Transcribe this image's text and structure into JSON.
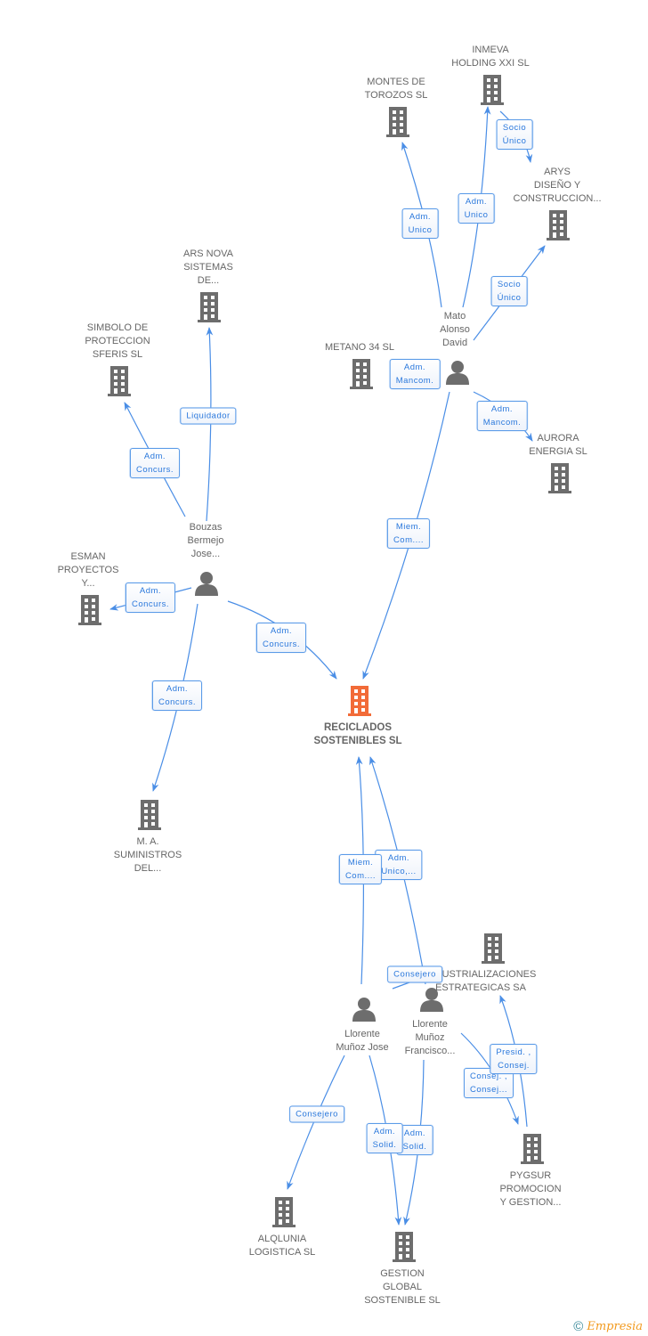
{
  "colors": {
    "edge": "#4a8ee6",
    "icon": "#6d6d6d",
    "focus": "#f26b38",
    "label_text": "#2a78dc"
  },
  "nodes": {
    "inmeva": {
      "label": "INMEVA\nHOLDING XXI SL",
      "type": "company"
    },
    "montes": {
      "label": "MONTES DE\nTOROZOS SL",
      "type": "company"
    },
    "arys": {
      "label": "ARYS\nDISEÑO Y\nCONSTRUCCION...",
      "type": "company"
    },
    "metano": {
      "label": "METANO 34 SL",
      "type": "company"
    },
    "aurora": {
      "label": "AURORA\nENERGIA SL",
      "type": "company"
    },
    "mato": {
      "label": "Mato\nAlonso\nDavid",
      "type": "person"
    },
    "arsnova": {
      "label": "ARS NOVA\nSISTEMAS\nDE...",
      "type": "company"
    },
    "simbolo": {
      "label": "SIMBOLO DE\nPROTECCION\nSFERIS SL",
      "type": "company"
    },
    "bouzas": {
      "label": "Bouzas\nBermejo\nJose...",
      "type": "person"
    },
    "esman": {
      "label": "ESMAN\nPROYECTOS\nY...",
      "type": "company"
    },
    "reciclados": {
      "label": "RECICLADOS\nSOSTENIBLES SL",
      "type": "company-focus"
    },
    "ma": {
      "label": "M. A.\nSUMINISTROS\nDEL...",
      "type": "company"
    },
    "industrializaciones": {
      "label": "INDUSTRIALIZACIONES\nESTRATEGICAS SA",
      "type": "company"
    },
    "ljose": {
      "label": "Llorente\nMuñoz Jose",
      "type": "person"
    },
    "lfrancisco": {
      "label": "Llorente\nMuñoz\nFrancisco...",
      "type": "person"
    },
    "pygsur": {
      "label": "PYGSUR\nPROMOCION\nY GESTION...",
      "type": "company"
    },
    "alqlunia": {
      "label": "ALQLUNIA\nLOGISTICA SL",
      "type": "company"
    },
    "gestion": {
      "label": "GESTION\nGLOBAL\nSOSTENIBLE SL",
      "type": "company"
    }
  },
  "edges": [
    {
      "from": "mato",
      "to": "montes",
      "label": "Adm.\nUnico"
    },
    {
      "from": "mato",
      "to": "inmeva",
      "label": "Adm.\nUnico"
    },
    {
      "from": "inmeva",
      "to": "arys",
      "label": "Socio\nÚnico"
    },
    {
      "from": "mato",
      "to": "arys",
      "label": "Socio\nÚnico"
    },
    {
      "from": "mato",
      "to": "metano",
      "label": "Adm.\nMancom."
    },
    {
      "from": "mato",
      "to": "aurora",
      "label": "Adm.\nMancom."
    },
    {
      "from": "mato",
      "to": "reciclados",
      "label": "Miem.\nCom...."
    },
    {
      "from": "bouzas",
      "to": "arsnova",
      "label": "Liquidador"
    },
    {
      "from": "bouzas",
      "to": "simbolo",
      "label": "Adm.\nConcurs."
    },
    {
      "from": "bouzas",
      "to": "esman",
      "label": "Adm.\nConcurs."
    },
    {
      "from": "bouzas",
      "to": "reciclados",
      "label": "Adm.\nConcurs."
    },
    {
      "from": "bouzas",
      "to": "ma",
      "label": "Adm.\nConcurs."
    },
    {
      "from": "ljose",
      "to": "reciclados",
      "label": "Miem.\nCom...."
    },
    {
      "from": "lfrancisco",
      "to": "reciclados",
      "label": "Adm.\nUnico,..."
    },
    {
      "from": "ljose",
      "to": "industrializaciones",
      "label": "Consejero"
    },
    {
      "from": "pygsur",
      "to": "industrializaciones",
      "label": "Presid. ,\nConsej."
    },
    {
      "from": "lfrancisco",
      "to": "pygsur",
      "label": "Consej. ,\nConsej..."
    },
    {
      "from": "ljose",
      "to": "alqlunia",
      "label": "Consejero"
    },
    {
      "from": "ljose",
      "to": "gestion",
      "label": "Adm.\nSolid."
    },
    {
      "from": "lfrancisco",
      "to": "gestion",
      "label": "Adm.\nSolid."
    }
  ],
  "footer": {
    "copyright": "©",
    "logo": "Empresia"
  }
}
